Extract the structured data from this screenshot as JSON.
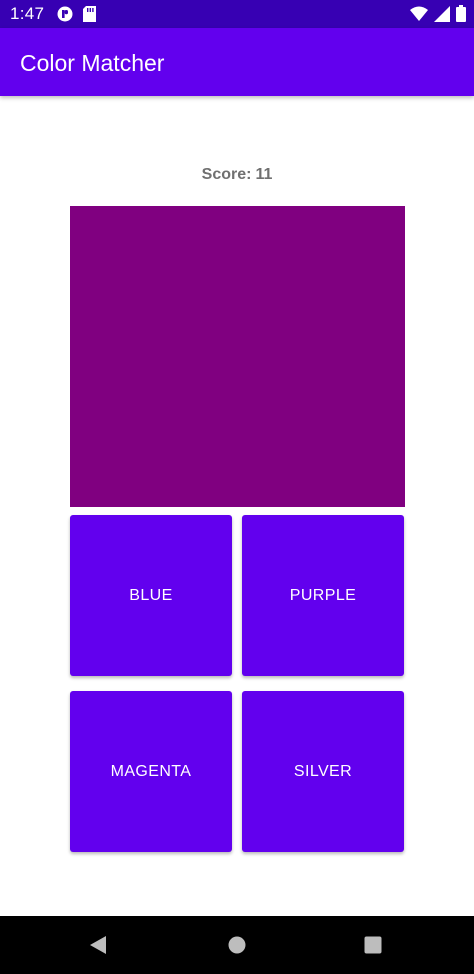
{
  "status_bar": {
    "time": "1:47",
    "icons": [
      "notification-icon",
      "sd-card-icon",
      "wifi-icon",
      "cellular-signal-icon",
      "battery-icon"
    ]
  },
  "app_bar": {
    "title": "Color Matcher"
  },
  "game": {
    "score_label": "Score:",
    "score_value": "11",
    "swatch_color": "#800080",
    "options": [
      "BLUE",
      "PURPLE",
      "MAGENTA",
      "SILVER"
    ]
  },
  "colors": {
    "primary": "#6200ee",
    "primary_dark": "#3700b3",
    "score_text": "#707070"
  },
  "nav_bar": {
    "icons": [
      "back-icon",
      "home-icon",
      "recents-icon"
    ]
  }
}
